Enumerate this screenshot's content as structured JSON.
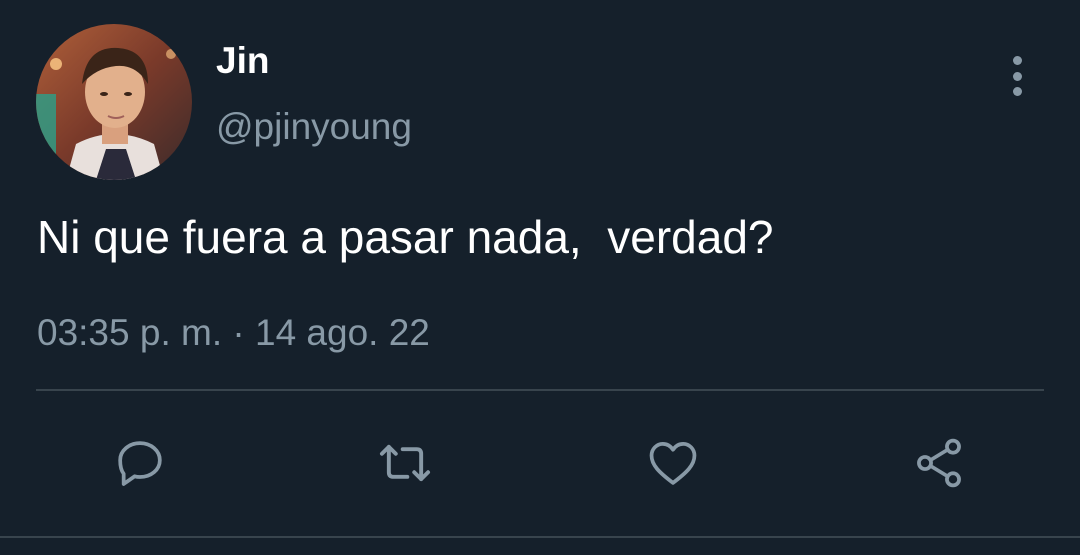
{
  "author": {
    "name": "Jin",
    "handle": "@pjinyoung"
  },
  "tweet": {
    "text": "Ni que fuera a pasar nada,  verdad?",
    "timestamp": "03:35 p. m. · 14 ago. 22"
  },
  "actions": [
    {
      "icon": "reply-icon"
    },
    {
      "icon": "retweet-icon"
    },
    {
      "icon": "like-icon"
    },
    {
      "icon": "share-icon"
    }
  ],
  "colors": {
    "background": "#15202b",
    "primary_text": "#ffffff",
    "secondary_text": "#8899a6",
    "divider": "#38444d"
  }
}
